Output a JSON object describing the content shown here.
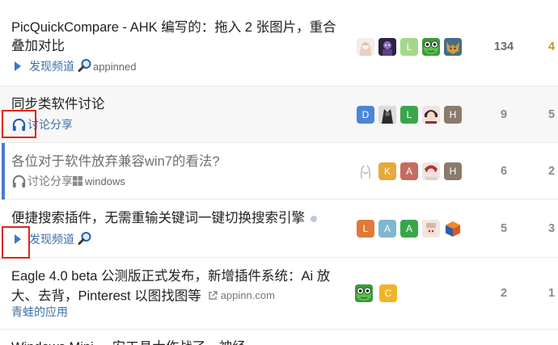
{
  "topics": [
    {
      "title": "PicQuickCompare - AHK 编写的：拖入 2 张图片，重合叠加对比",
      "category": "发现频道",
      "tag": "appinned",
      "posters": [
        "anime-girl-avatar",
        "purple-character-avatar",
        "L",
        "frog-avatar",
        "fox-avatar"
      ],
      "replies": "134",
      "views": "4"
    },
    {
      "title": "同步类软件讨论",
      "category": "讨论分享",
      "posters": [
        "D",
        "dark-character-avatar",
        "L",
        "portrait-avatar",
        "H"
      ],
      "replies": "9",
      "views": "5"
    },
    {
      "title": "各位对于软件放弃兼容win7的看法?",
      "category": "讨论分享",
      "tag": "windows",
      "posters": [
        "sketch-avatar",
        "K",
        "A",
        "red-character-avatar",
        "H"
      ],
      "replies": "6",
      "views": "2"
    },
    {
      "title": "便捷搜索插件，无需重输关键词一键切换搜索引擎",
      "category": "发现频道",
      "posters": [
        "L",
        "A",
        "A",
        "pixel-avatar",
        "cube-avatar"
      ],
      "replies": "5",
      "views": "3"
    },
    {
      "title": "Eagle 4.0 beta 公测版正式发布，新增插件系统：Ai 放大、去背，Pinterest 以图找图等",
      "domain": "appinn.com",
      "category": "青蛙的应用",
      "posters": [
        "frog-avatar",
        "C"
      ],
      "replies": "2",
      "views": "1"
    },
    {
      "title": "Windows Mini ... 安工具大作战了一神经"
    }
  ],
  "colors": {
    "link": "#3f6fa8",
    "accent": "#3d78c7",
    "annotation": "#e0241b",
    "L_green": "#6cc04a",
    "D_blue": "#4a86d8",
    "H_brown": "#8c7b6b",
    "K_yellow": "#e6a93a",
    "A_red": "#c76b5f",
    "A_teal": "#7fb6cf",
    "A_green": "#3aa64a",
    "L_orange": "#e07a36",
    "C_yellow": "#f0b429"
  }
}
